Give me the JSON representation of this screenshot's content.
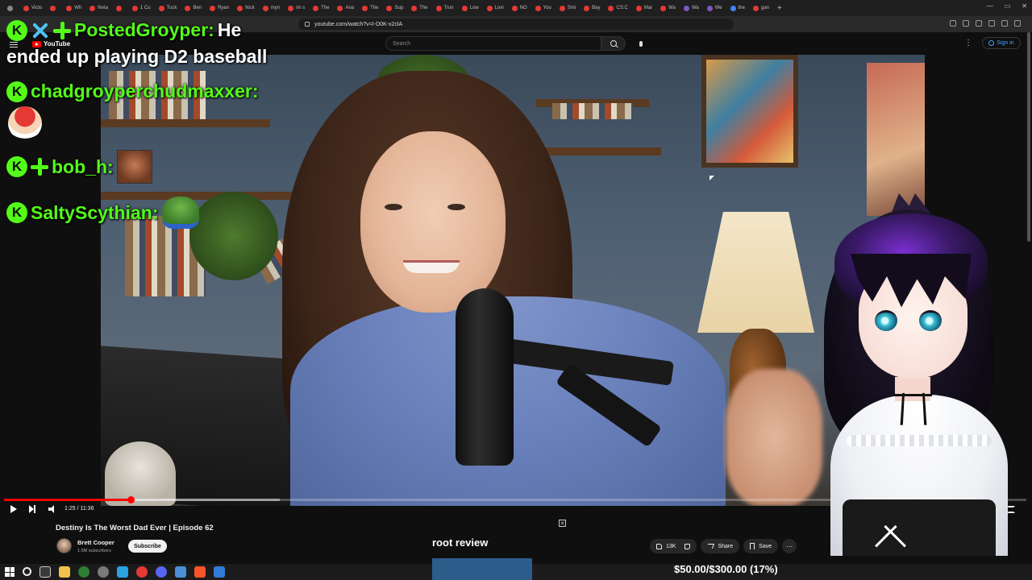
{
  "browser": {
    "tabs": [
      "",
      "Victo",
      "",
      "Wh",
      "Neta",
      "",
      "1 Cu",
      "Tuck",
      "Ben",
      "Ryan",
      "Nick",
      "myn",
      "im s",
      "The",
      "Ana",
      "The",
      "Sup",
      "The",
      "Trun",
      "Low",
      "Lovi",
      "NO",
      "You",
      "Smi",
      "Bay",
      "CS:C",
      "Mar",
      "Wa",
      "Wa",
      "We",
      "the",
      "gan"
    ],
    "url": "youtube.com/watch?v=I-D0K-x2clA"
  },
  "youtube": {
    "logo_text": "YouTube",
    "search_placeholder": "Search",
    "signin_label": "Sign in",
    "more_menu": "⋮"
  },
  "player": {
    "time": "1:25 / 11:36",
    "progress_fraction": 0.124,
    "buffered_fraction": 0.27
  },
  "video_info": {
    "title": "Destiny Is The Worst Dad Ever | Episode 62",
    "channel": "Brett Cooper",
    "subscribers": "1.5M subscribers",
    "subscribe_label": "Subscribe",
    "likes": "13K",
    "share_label": "Share",
    "save_label": "Save",
    "more_label": "⋯"
  },
  "chat": [
    {
      "name": "PostedGroyper:",
      "message": "He",
      "continuation": "ended up playing D2 baseball"
    },
    {
      "name": "chadgroyperchudmaxxer:",
      "message": ""
    },
    {
      "name": "bob_h:",
      "message": ""
    },
    {
      "name": "SaltyScythian:",
      "message": ""
    }
  ],
  "kick_badge": "K",
  "stream": {
    "topic": "root review",
    "goal": "$50.00/$300.00 (17%)"
  },
  "colors": {
    "accent_green": "#53fc18",
    "youtube_red": "#ff0000",
    "link_blue": "#3ea6ff"
  }
}
